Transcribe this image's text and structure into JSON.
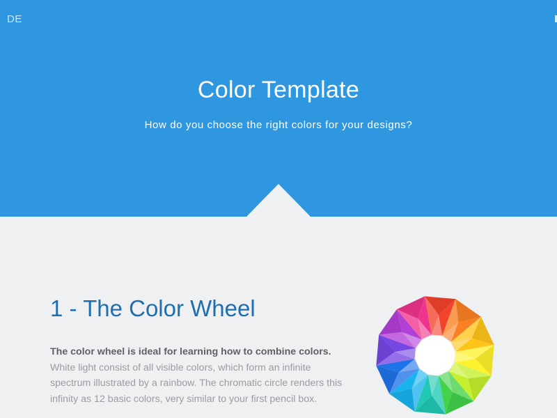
{
  "header": {
    "lang_label": "DE",
    "title": "Color Template",
    "subtitle": "How do you choose the right colors for your designs?"
  },
  "section": {
    "title": "1 - The Color Wheel",
    "lead": "The color wheel is ideal for learning how to combine colors.",
    "body": " White light consist of all visible colors, which form an infinite spectrum illustrated by a rainbow. The chromatic circle renders this infinity as 12 basic colors, very similar to your first pencil box."
  },
  "colors": {
    "hero_bg": "#2f97e0",
    "page_bg": "#eff0f2",
    "title_blue": "#1f6fb0"
  },
  "wheel_colors": [
    "#f2432c",
    "#fa8022",
    "#ffc41a",
    "#fff12d",
    "#c6ef2e",
    "#43d24a",
    "#20c9b3",
    "#1ab3ee",
    "#1f73e8",
    "#7548e3",
    "#b23fd6",
    "#f0348d"
  ]
}
